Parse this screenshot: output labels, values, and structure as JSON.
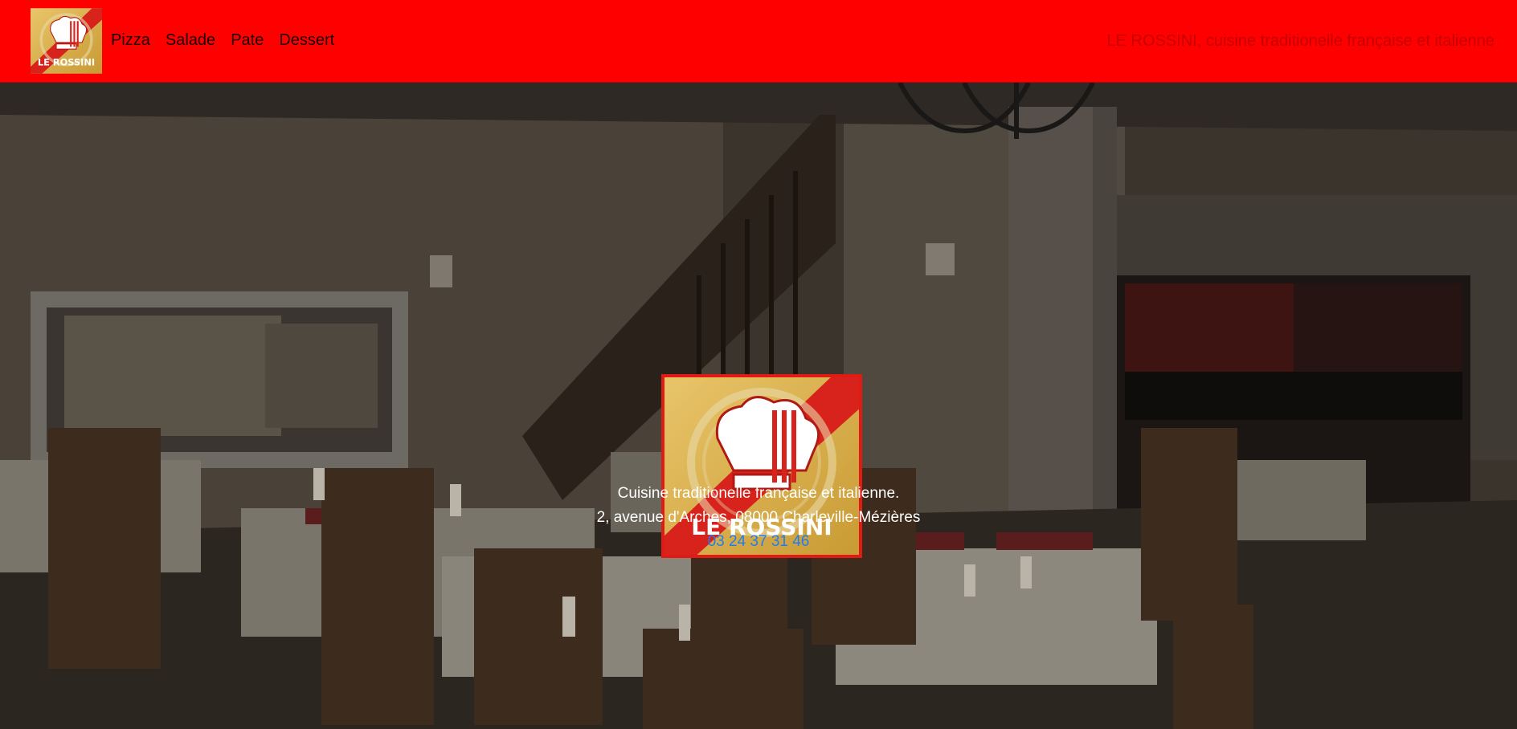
{
  "navbar": {
    "logo_text": "LE ROSSINI",
    "links": [
      {
        "label": "Pizza"
      },
      {
        "label": "Salade"
      },
      {
        "label": "Pate"
      },
      {
        "label": "Dessert"
      }
    ],
    "tagline": "LE ROSSINI, cuisine traditionelle française et italienne"
  },
  "hero": {
    "logo_text": "LE ROSSINI",
    "line1": "Cuisine traditionelle française et italienne.",
    "line2": "2, avenue d'Arches, 08000 Charleville-Mézières",
    "phone": "03 24 37 31 46"
  },
  "colors": {
    "header_bg": "#ff0000",
    "phone_link": "#1e7ef0",
    "text_light": "#ffffff"
  },
  "icons": {
    "logo": "chef-hat-fork-logo"
  }
}
